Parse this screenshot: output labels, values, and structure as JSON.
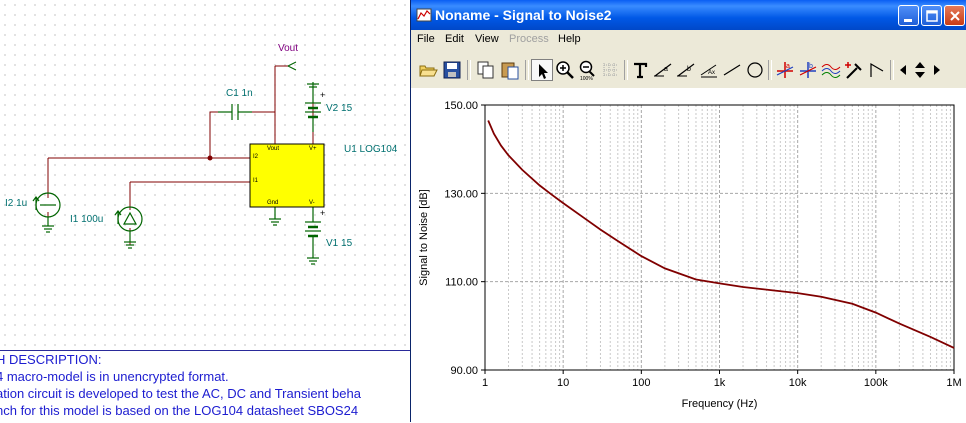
{
  "schematic": {
    "labels": {
      "vout": "Vout",
      "c1": "C1 1n",
      "v2": "V2 15",
      "u1": "U1 LOG104",
      "i2": "I2 1u",
      "i1": "I1 100u",
      "v1": "V1 15"
    },
    "pins": {
      "i2": "I2",
      "i1": "I1",
      "vout": "Vout",
      "gnd": "Gnd",
      "vplus": "V+",
      "vminus": "V-"
    },
    "description": [
      "H DESCRIPTION:",
      "4 macro-model is in unencrypted format.",
      "ation circuit is developed to test the AC, DC and Transient beha",
      "nch for this model is based on the LOG104 datasheet SBOS24"
    ]
  },
  "window": {
    "title": "Noname - Signal to Noise2",
    "menu": [
      "File",
      "Edit",
      "View",
      "Process",
      "Help"
    ],
    "menu_disabled": [
      false,
      false,
      false,
      true,
      false
    ],
    "toolbar_icons": [
      "open-icon",
      "save-icon",
      "copy-icon",
      "paste-icon",
      "pointer-icon",
      "zoom-in-icon",
      "zoom-100-icon",
      "grid-icon",
      "text-icon",
      "cursor-a-icon",
      "cursor-b-icon",
      "axis-text-icon",
      "line-icon",
      "circle-icon",
      "cursor-a-marker-icon",
      "cursor-b-marker-icon",
      "curves-icon",
      "add-marker-icon",
      "slope-icon",
      "prev-icon",
      "up-down-icon",
      "next-icon"
    ]
  },
  "chart_data": {
    "type": "line",
    "xlabel": "Frequency (Hz)",
    "ylabel": "Signal to Noise [dB]",
    "xscale": "log",
    "xlim": [
      1,
      1000000
    ],
    "ylim": [
      90,
      150
    ],
    "x_ticks": [
      1,
      10,
      100,
      1000,
      10000,
      100000,
      1000000
    ],
    "x_tick_labels": [
      "1",
      "10",
      "100",
      "1k",
      "10k",
      "100k",
      "1M"
    ],
    "y_ticks": [
      90,
      110,
      130,
      150
    ],
    "y_tick_labels": [
      "90.00",
      "110.00",
      "130.00",
      "150.00"
    ],
    "grid": true,
    "line_color": "#800000",
    "series": [
      {
        "x": [
          1.1,
          1.3,
          1.6,
          2,
          3,
          5,
          7,
          10,
          20,
          30,
          50,
          100,
          200,
          500,
          1000,
          2000,
          5000,
          10000,
          20000,
          50000,
          100000,
          200000,
          500000,
          1000000
        ],
        "y": [
          146.5,
          143.5,
          140.8,
          138.6,
          135.3,
          131.8,
          129.8,
          127.8,
          124.0,
          121.8,
          119.2,
          115.8,
          113.0,
          110.5,
          109.6,
          108.8,
          108.0,
          107.4,
          106.6,
          105.0,
          103.0,
          100.5,
          97.5,
          95.0
        ]
      }
    ]
  }
}
